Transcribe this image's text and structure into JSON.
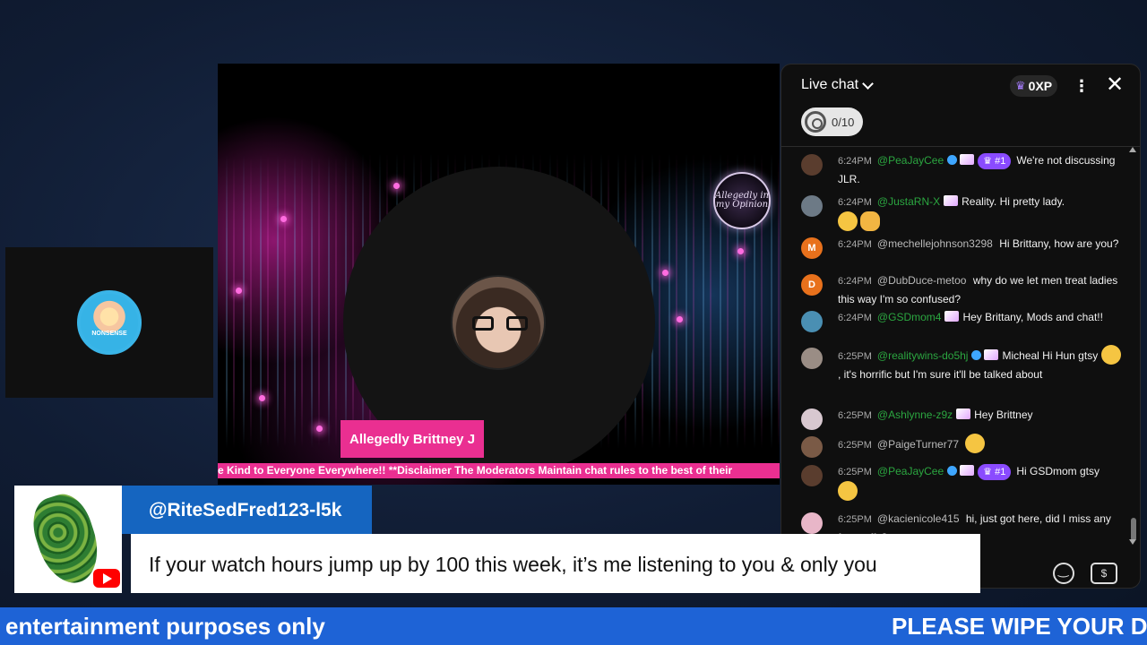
{
  "video": {
    "name_tag": "Allegedly Brittney J",
    "ticker": "e Kind to Everyone Everywhere!! **Disclaimer The Moderators Maintain chat rules to the best of their",
    "logo_text": "Allegedly in my Opinion"
  },
  "guest": {
    "avatar_label": "NONSENSE"
  },
  "chat": {
    "title": "Live chat",
    "xp": "0XP",
    "goal": "0/10",
    "messages": [
      {
        "time": "6:24PM",
        "author": "@PeaJayCee",
        "verified": true,
        "rank": "#1",
        "text": "We're not discussing JLR.",
        "avatar_color": "#5a3d2e"
      },
      {
        "time": "6:24PM",
        "author": "@JustaRN-X",
        "text": "Reality. Hi pretty lady.",
        "avatar_color": "#6d7a86"
      },
      {
        "time": "6:24PM",
        "author": "@mechellejohnson3298",
        "text": "Hi Brittany, how are you?",
        "avatar_letter": "M",
        "avatar_color": "#e8711c"
      },
      {
        "time": "6:24PM",
        "author": "@DubDuce-metoo",
        "text": "why do we let men treat ladies this way I'm so confused?",
        "avatar_letter": "D",
        "avatar_color": "#e8711c"
      },
      {
        "time": "6:24PM",
        "author": "@GSDmom4",
        "text": "Hey Brittany, Mods and chat!!",
        "avatar_color": "#4a8fb3"
      },
      {
        "time": "6:25PM",
        "author": "@realitywins-do5hj",
        "verified": true,
        "text_a": "Micheal Hi Hun gtsy",
        "text_b": ", it's horrific but I'm sure it'll be talked about",
        "avatar_color": "#9a8d85"
      },
      {
        "time": "6:25PM",
        "author": "@Ashlynne-z9z",
        "text": "Hey Brittney",
        "avatar_color": "#d8c8d0"
      },
      {
        "time": "6:25PM",
        "author": "@PaigeTurner77",
        "text": "",
        "avatar_color": "#7a5a46"
      },
      {
        "time": "6:25PM",
        "author": "@PeaJayCee",
        "verified": true,
        "rank": "#1",
        "text": "Hi GSDmom gtsy",
        "avatar_color": "#5a3d2e"
      },
      {
        "time": "6:25PM",
        "author": "@kacienicole415",
        "text": "hi, just got here, did I miss any fun stuffs?",
        "avatar_color": "#e8b6c8"
      }
    ]
  },
  "comment": {
    "user": "@RiteSedFred123-l5k",
    "text": "If your watch hours jump up by 100 this week, it’s me listening to you & only you"
  },
  "banner": {
    "left": "entertainment purposes only",
    "right": "PLEASE WIPE YOUR DI"
  },
  "colors": {
    "pink": "#ea2f91",
    "banner_blue": "#1e63d6",
    "username_green": "#2ba640"
  }
}
